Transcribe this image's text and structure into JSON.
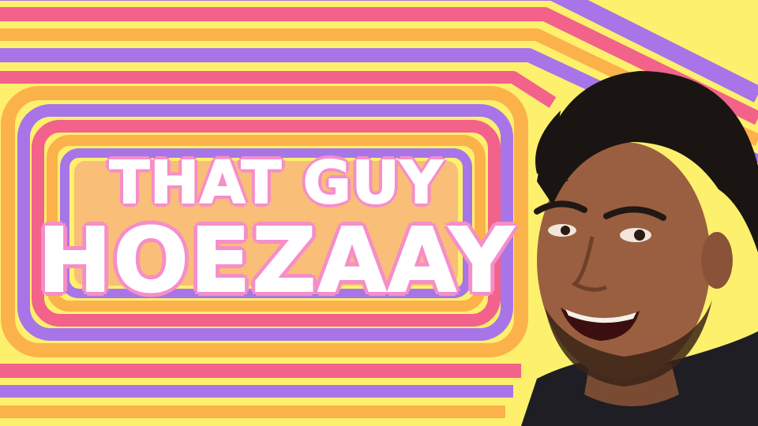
{
  "thumbnail": {
    "title_line1": "THAT GUY",
    "title_line2": "HOEZAAY"
  },
  "colors": {
    "yellow": "#fdf06d",
    "orange": "#fbb24a",
    "pink": "#f2628a",
    "purple": "#a775e8",
    "text_outline": "#f58ec9"
  },
  "person": {
    "description_icon": "person-photo"
  }
}
